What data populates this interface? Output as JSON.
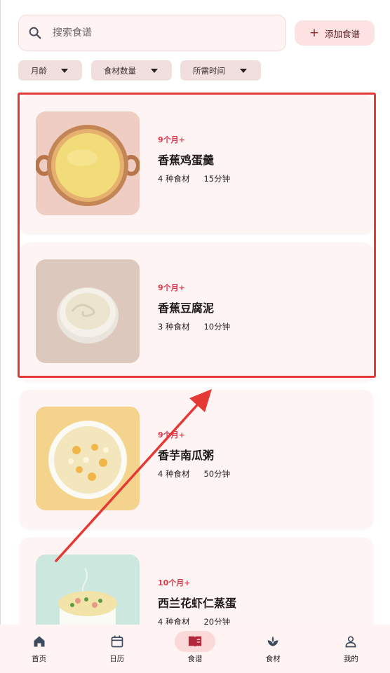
{
  "search": {
    "placeholder": "搜索食谱"
  },
  "add_button": {
    "label": "添加食谱"
  },
  "filters": [
    {
      "label": "月龄"
    },
    {
      "label": "食材数量"
    },
    {
      "label": "所需时间"
    }
  ],
  "recipes": [
    {
      "age": "9个月+",
      "title": "香蕉鸡蛋羹",
      "ingredients": "4 种食材",
      "time": "15分钟"
    },
    {
      "age": "9个月+",
      "title": "香蕉豆腐泥",
      "ingredients": "3 种食材",
      "time": "10分钟"
    },
    {
      "age": "9个月+",
      "title": "香芋南瓜粥",
      "ingredients": "4 种食材",
      "time": "50分钟"
    },
    {
      "age": "10个月+",
      "title": "西兰花虾仁蒸蛋",
      "ingredients": "4 种食材",
      "time": "20分钟"
    }
  ],
  "nav": [
    {
      "label": "首页",
      "icon": "home-icon"
    },
    {
      "label": "日历",
      "icon": "calendar-icon"
    },
    {
      "label": "食谱",
      "icon": "recipe-book-icon",
      "active": true
    },
    {
      "label": "食材",
      "icon": "ingredient-sprout-icon"
    },
    {
      "label": "我的",
      "icon": "profile-icon"
    }
  ],
  "colors": {
    "accent": "#d83a4c",
    "highlight": "#e53935",
    "card": "#fff4f4",
    "nav_bg": "#fff4f3"
  }
}
